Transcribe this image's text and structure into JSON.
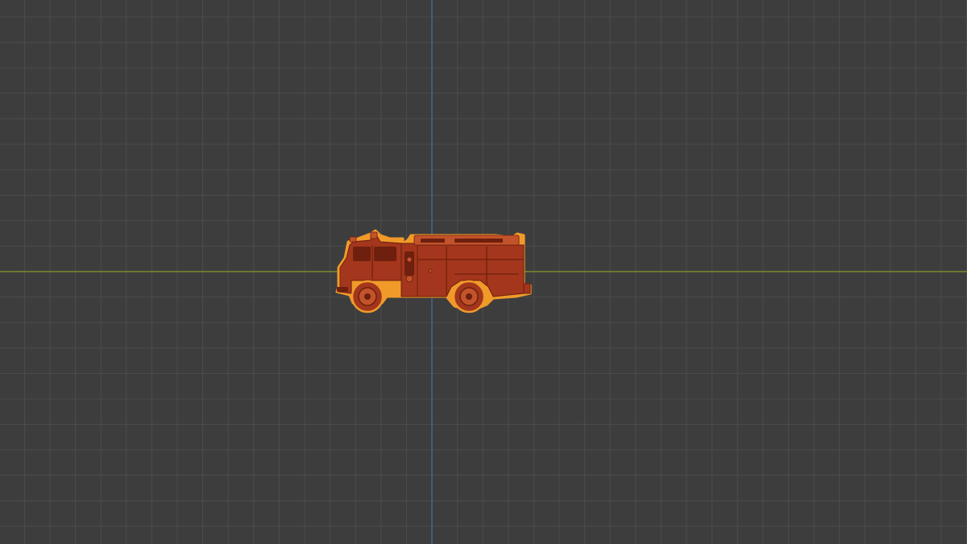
{
  "viewport": {
    "background_color": "#3d3d3d",
    "grid_line_color": "#4c4c4c",
    "x_axis_color": "#8a9a2c",
    "y_axis_color": "#4f6f9a"
  },
  "scene": {
    "object": {
      "icon": "fire-truck-model",
      "selected": true,
      "body_color": "#a3361c",
      "shadow_color": "#6e1f0e",
      "highlight_color": "#c2532b",
      "selection_outline_color": "#f09a2a"
    }
  }
}
